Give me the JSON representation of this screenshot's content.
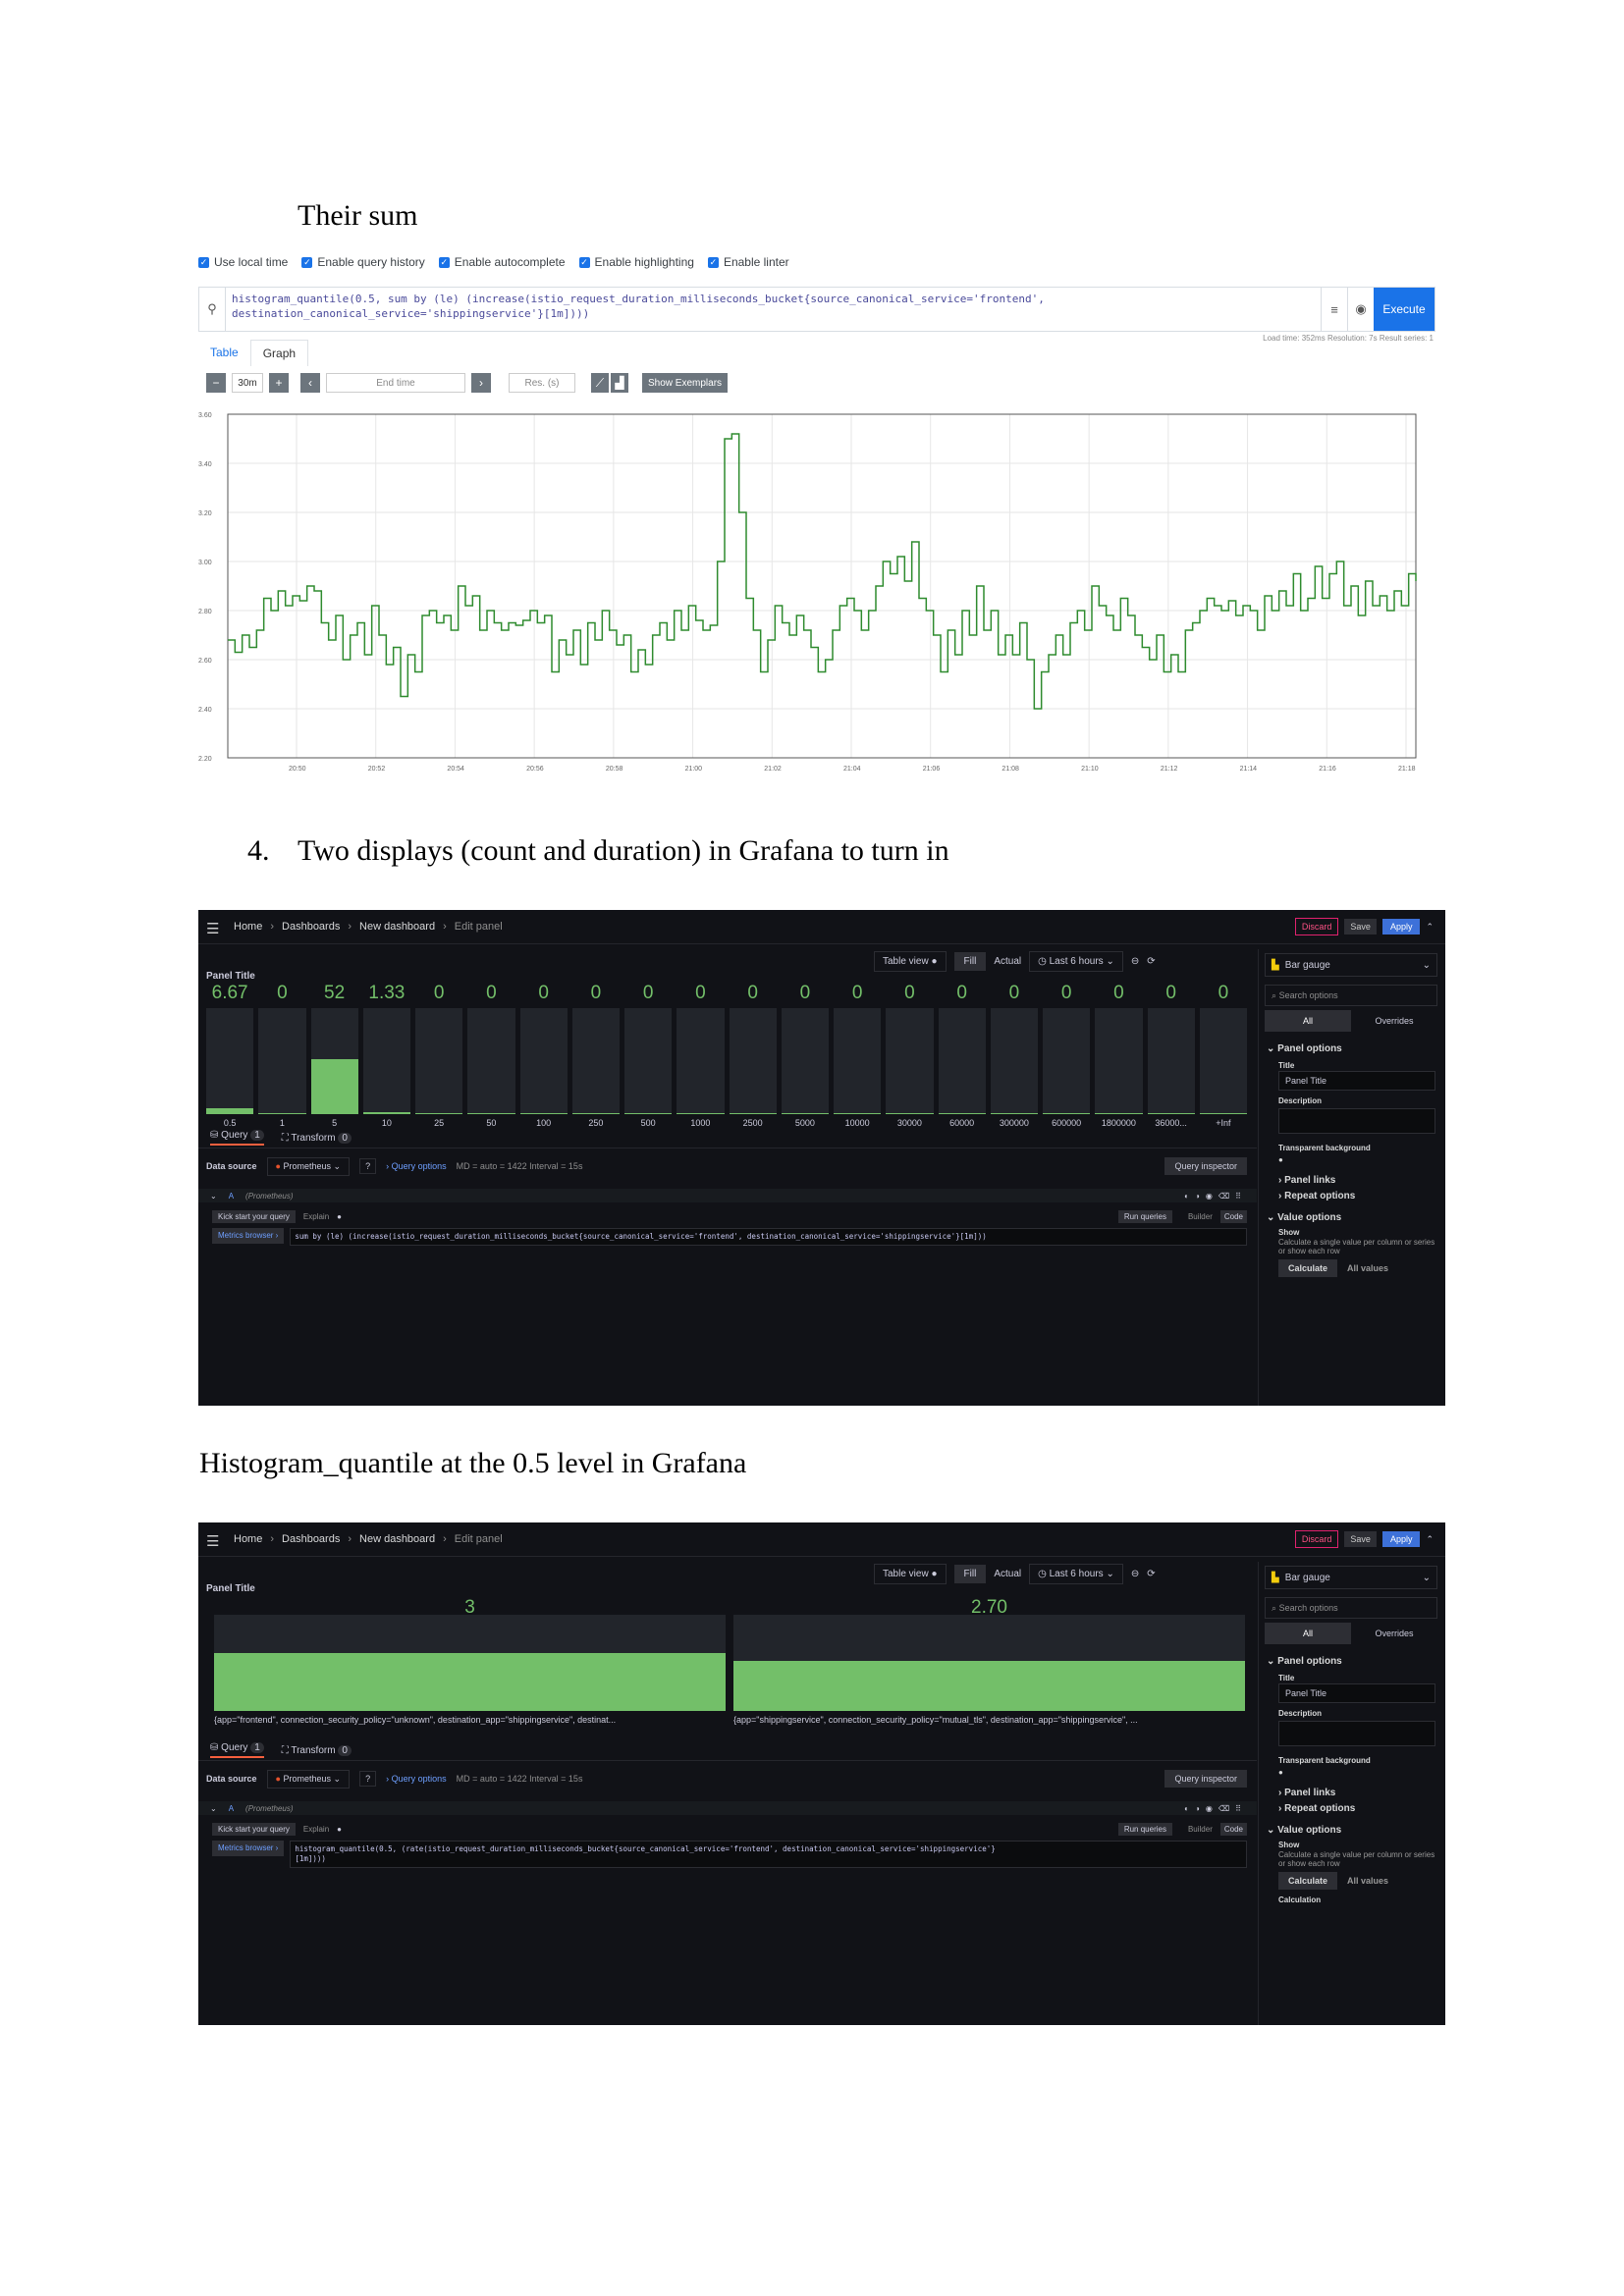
{
  "heading_sum": "Their sum",
  "item_number": "4.",
  "heading_item4": "Two displays (count and duration) in Grafana to turn in",
  "heading_quantile": "Histogram_quantile at the 0.5 level in Grafana",
  "prometheus": {
    "checkboxes": [
      "Use local time",
      "Enable query history",
      "Enable autocomplete",
      "Enable highlighting",
      "Enable linter"
    ],
    "query_line1": "histogram_quantile(0.5, sum by (le) (increase(istio_request_duration_milliseconds_bucket{source_canonical_service='frontend',",
    "query_line2": "destination_canonical_service='shippingservice'}[1m])))",
    "execute_label": "Execute",
    "stats": "Load time: 352ms   Resolution: 7s   Result series: 1",
    "tabs": [
      "Table",
      "Graph"
    ],
    "range": "30m",
    "end_time_placeholder": "End time",
    "res_placeholder": "Res. (s)",
    "show_exemplars": "Show Exemplars",
    "line_color": "#2e8b2e"
  },
  "chart_data": {
    "type": "line",
    "title": "",
    "xlabel": "",
    "ylabel": "",
    "ylim": [
      2.2,
      3.6
    ],
    "y_ticks": [
      "2.20",
      "2.40",
      "2.60",
      "2.80",
      "3.00",
      "3.20",
      "3.40",
      "3.60"
    ],
    "x_ticks": [
      "20:50",
      "20:52",
      "20:54",
      "20:56",
      "20:58",
      "21:00",
      "21:02",
      "21:04",
      "21:06",
      "21:08",
      "21:10",
      "21:12",
      "21:14",
      "21:16",
      "21:18"
    ],
    "series": [
      {
        "values": [
          2.68,
          2.63,
          2.7,
          2.65,
          2.72,
          2.85,
          2.8,
          2.88,
          2.82,
          2.86,
          2.84,
          2.9,
          2.88,
          2.75,
          2.68,
          2.78,
          2.6,
          2.7,
          2.75,
          2.62,
          2.82,
          2.7,
          2.58,
          2.65,
          2.45,
          2.62,
          2.55,
          2.78,
          2.8,
          2.75,
          2.78,
          2.72,
          2.9,
          2.82,
          2.86,
          2.72,
          2.8,
          2.75,
          2.72,
          2.75,
          2.74,
          2.76,
          2.8,
          2.75,
          2.78,
          2.55,
          2.68,
          2.62,
          2.72,
          2.58,
          2.75,
          2.68,
          2.8,
          2.72,
          2.66,
          2.7,
          2.55,
          2.64,
          2.58,
          2.7,
          2.75,
          2.68,
          2.8,
          2.72,
          2.82,
          2.76,
          2.72,
          2.74,
          3.0,
          3.5,
          3.52,
          3.2,
          2.85,
          2.72,
          2.55,
          2.68,
          2.82,
          2.75,
          2.7,
          2.78,
          2.72,
          2.65,
          2.55,
          2.6,
          2.72,
          2.82,
          2.85,
          2.8,
          2.72,
          2.8,
          2.9,
          3.0,
          2.95,
          3.02,
          2.92,
          3.08,
          2.85,
          2.8,
          2.7,
          2.55,
          2.72,
          2.62,
          2.8,
          2.7,
          2.9,
          2.72,
          2.8,
          2.62,
          2.7,
          2.62,
          2.75,
          2.6,
          2.4,
          2.55,
          2.62,
          2.7,
          2.62,
          2.75,
          2.8,
          2.72,
          2.9,
          2.82,
          2.78,
          2.72,
          2.85,
          2.78,
          2.7,
          2.65,
          2.6,
          2.7,
          2.55,
          2.62,
          2.55,
          2.72,
          2.75,
          2.8,
          2.85,
          2.82,
          2.8,
          2.84,
          2.78,
          2.82,
          2.8,
          2.72,
          2.86,
          2.8,
          2.88,
          2.82,
          2.95,
          2.8,
          2.85,
          2.98,
          2.85,
          2.95,
          3.0,
          2.82,
          2.9,
          2.78,
          2.92,
          2.82,
          2.86,
          2.8,
          2.88,
          2.82,
          2.95,
          2.92
        ]
      }
    ]
  },
  "grafana_common": {
    "crumbs": [
      "Home",
      "Dashboards",
      "New dashboard",
      "Edit panel"
    ],
    "discard": "Discard",
    "save": "Save",
    "apply": "Apply",
    "table_view": "Table view",
    "fill": "Fill",
    "actual": "Actual",
    "time_range": "Last 6 hours",
    "viz": "Bar gauge",
    "search_options": "Search options",
    "all": "All",
    "overrides": "Overrides",
    "panel_options": "Panel options",
    "title_label": "Title",
    "title_value": "Panel Title",
    "description_label": "Description",
    "transparent_bg": "Transparent background",
    "panel_links": "Panel links",
    "repeat_options": "Repeat options",
    "value_options": "Value options",
    "show_label": "Show",
    "show_help": "Calculate a single value per column or series or show each row",
    "calculate": "Calculate",
    "all_values": "All values",
    "calculation": "Calculation",
    "panel_title": "Panel Title",
    "query_tab": "Query",
    "query_count": "1",
    "transform_tab": "Transform",
    "transform_count": "0",
    "data_source_label": "Data source",
    "data_source": "Prometheus",
    "query_options": "Query options",
    "query_meta": "MD = auto = 1422   Interval = 15s",
    "query_inspector": "Query inspector",
    "query_ref": "A",
    "query_ds": "(Prometheus)",
    "kick_start": "Kick start your query",
    "explain": "Explain",
    "run_queries": "Run queries",
    "builder": "Builder",
    "code": "Code",
    "metrics_browser": "Metrics browser",
    "bar_color": "#73bf69",
    "bg_color": "#111217"
  },
  "grafana1": {
    "values": [
      "6.67",
      "0",
      "52",
      "1.33",
      "0",
      "0",
      "0",
      "0",
      "0",
      "0",
      "0",
      "0",
      "0",
      "0",
      "0",
      "0",
      "0",
      "0",
      "0",
      "0"
    ],
    "fill_fraction": [
      0.06,
      0.0,
      0.52,
      0.015,
      0,
      0,
      0,
      0,
      0,
      0,
      0,
      0,
      0,
      0,
      0,
      0,
      0,
      0,
      0,
      0
    ],
    "labels": [
      "0.5",
      "1",
      "5",
      "10",
      "25",
      "50",
      "100",
      "250",
      "500",
      "1000",
      "2500",
      "5000",
      "10000",
      "30000",
      "60000",
      "300000",
      "600000",
      "1800000",
      "36000...",
      "+Inf"
    ],
    "query": "sum by (le) (increase(istio_request_duration_milliseconds_bucket{source_canonical_service='frontend', destination_canonical_service='shippingservice'}[1m]))"
  },
  "grafana2": {
    "values": [
      "3",
      "2.70"
    ],
    "fill_fraction": [
      0.6,
      0.52
    ],
    "labels": [
      "{app=\"frontend\", connection_security_policy=\"unknown\", destination_app=\"shippingservice\", destinat...",
      "{app=\"shippingservice\", connection_security_policy=\"mutual_tls\", destination_app=\"shippingservice\", ..."
    ],
    "query_line1": "histogram_quantile(0.5, (rate(istio_request_duration_milliseconds_bucket{source_canonical_service='frontend', destination_canonical_service='shippingservice'}",
    "query_line2": "[1m])))"
  }
}
